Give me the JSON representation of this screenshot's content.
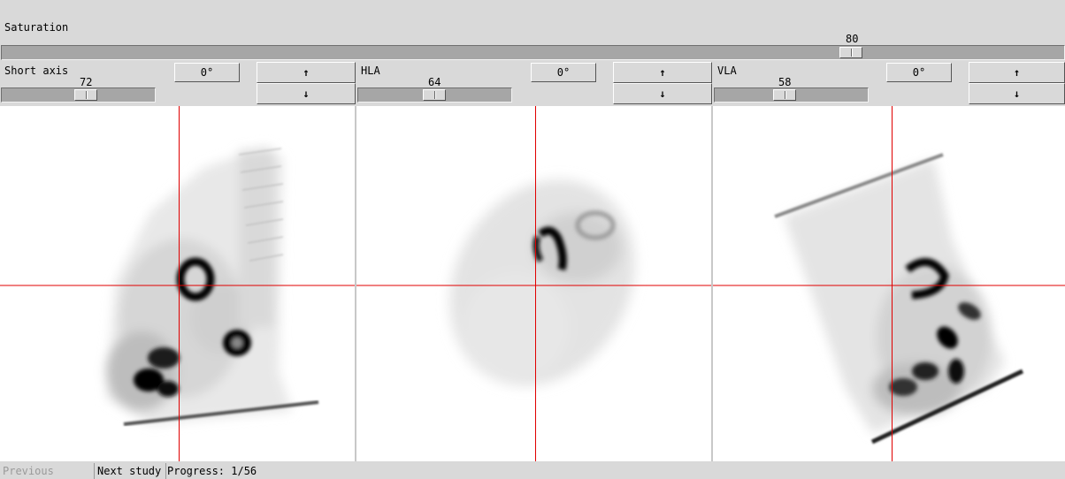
{
  "saturation": {
    "label": "Saturation",
    "value": "80",
    "level_percent": 80
  },
  "panels": [
    {
      "label": "Short axis",
      "slider_value": "72",
      "rotation_label": "0°",
      "up_label": "↑",
      "down_label": "↓"
    },
    {
      "label": "HLA",
      "slider_value": "64",
      "rotation_label": "0°",
      "up_label": "↑",
      "down_label": "↓"
    },
    {
      "label": "VLA",
      "slider_value": "58",
      "rotation_label": "0°",
      "up_label": "↑",
      "down_label": "↓"
    }
  ],
  "footer": {
    "previous_label": "Previous study",
    "previous_enabled": false,
    "next_label": "Next study",
    "progress_text": "Progress: 1/56"
  },
  "colors": {
    "crosshair": "#e00000",
    "background": "#d9d9d9",
    "view_background": "#ffffff"
  }
}
